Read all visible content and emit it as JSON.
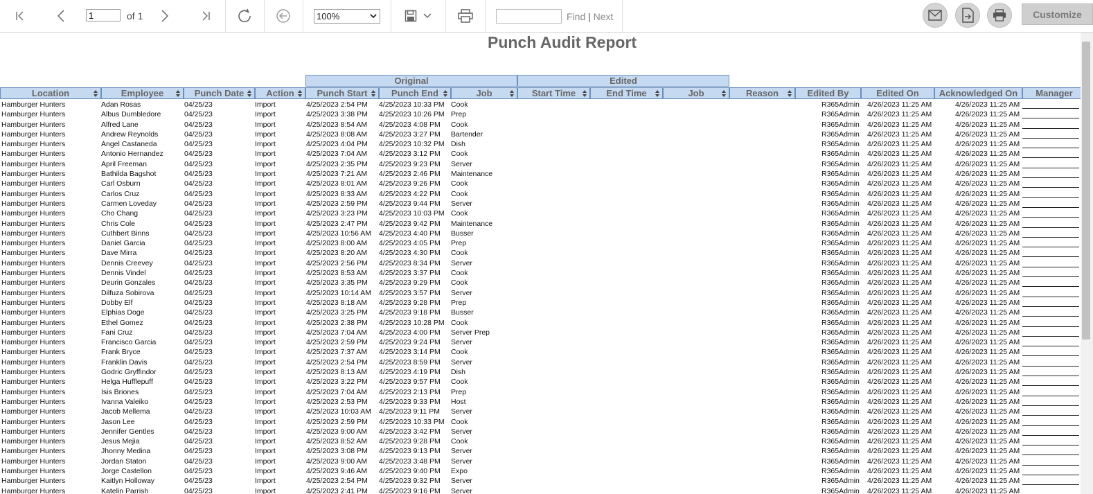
{
  "toolbar": {
    "page_value": "1",
    "page_of": "of 1",
    "zoom": "100%",
    "find_label": "Find",
    "next_label": "Next",
    "find_sep": "|",
    "customize": "Customize"
  },
  "report": {
    "title": "Punch Audit Report",
    "group_original": "Original",
    "group_edited": "Edited",
    "columns": [
      "Location",
      "Employee",
      "Punch Date",
      "Action",
      "Punch Start",
      "Punch End",
      "Job",
      "Start Time",
      "End Time",
      "Job",
      "Reason",
      "Edited By",
      "Edited On",
      "Acknowledged On",
      "Manager"
    ],
    "rows": [
      [
        "Hamburger Hunters",
        "Adan Rosas",
        "04/25/23",
        "Import",
        "4/25/2023 2:54 PM",
        "4/25/2023 10:33 PM",
        "Cook",
        "R365Admin",
        "4/26/2023 11:25 AM",
        "4/26/2023 11:25 AM"
      ],
      [
        "Hamburger Hunters",
        "Albus Dumbledore",
        "04/25/23",
        "Import",
        "4/25/2023 3:38 PM",
        "4/25/2023 10:26 PM",
        "Prep",
        "R365Admin",
        "4/26/2023 11:25 AM",
        "4/26/2023 11:25 AM"
      ],
      [
        "Hamburger Hunters",
        "Alfred Lane",
        "04/25/23",
        "Import",
        "4/25/2023 8:54 AM",
        "4/25/2023 4:08 PM",
        "Cook",
        "R365Admin",
        "4/26/2023 11:25 AM",
        "4/26/2023 11:25 AM"
      ],
      [
        "Hamburger Hunters",
        "Andrew Reynolds",
        "04/25/23",
        "Import",
        "4/25/2023 8:08 AM",
        "4/25/2023 3:27 PM",
        "Bartender",
        "R365Admin",
        "4/26/2023 11:25 AM",
        "4/26/2023 11:25 AM"
      ],
      [
        "Hamburger Hunters",
        "Angel Castaneda",
        "04/25/23",
        "Import",
        "4/25/2023 4:04 PM",
        "4/25/2023 10:32 PM",
        "Dish",
        "R365Admin",
        "4/26/2023 11:25 AM",
        "4/26/2023 11:25 AM"
      ],
      [
        "Hamburger Hunters",
        "Antonio Hernandez",
        "04/25/23",
        "Import",
        "4/25/2023 7:04 AM",
        "4/25/2023 3:12 PM",
        "Cook",
        "R365Admin",
        "4/26/2023 11:25 AM",
        "4/26/2023 11:25 AM"
      ],
      [
        "Hamburger Hunters",
        "April Freeman",
        "04/25/23",
        "Import",
        "4/25/2023 2:35 PM",
        "4/25/2023 9:23 PM",
        "Server",
        "R365Admin",
        "4/26/2023 11:25 AM",
        "4/26/2023 11:25 AM"
      ],
      [
        "Hamburger Hunters",
        "Bathilda Bagshot",
        "04/25/23",
        "Import",
        "4/25/2023 7:21 AM",
        "4/25/2023 2:46 PM",
        "Maintenance",
        "R365Admin",
        "4/26/2023 11:25 AM",
        "4/26/2023 11:25 AM"
      ],
      [
        "Hamburger Hunters",
        "Carl Osburn",
        "04/25/23",
        "Import",
        "4/25/2023 8:01 AM",
        "4/25/2023 9:26 PM",
        "Cook",
        "R365Admin",
        "4/26/2023 11:25 AM",
        "4/26/2023 11:25 AM"
      ],
      [
        "Hamburger Hunters",
        "Carlos Cruz",
        "04/25/23",
        "Import",
        "4/25/2023 8:33 AM",
        "4/25/2023 4:22 PM",
        "Cook",
        "R365Admin",
        "4/26/2023 11:25 AM",
        "4/26/2023 11:25 AM"
      ],
      [
        "Hamburger Hunters",
        "Carmen Loveday",
        "04/25/23",
        "Import",
        "4/25/2023 2:59 PM",
        "4/25/2023 9:44 PM",
        "Server",
        "R365Admin",
        "4/26/2023 11:25 AM",
        "4/26/2023 11:25 AM"
      ],
      [
        "Hamburger Hunters",
        "Cho Chang",
        "04/25/23",
        "Import",
        "4/25/2023 3:23 PM",
        "4/25/2023 10:03 PM",
        "Cook",
        "R365Admin",
        "4/26/2023 11:25 AM",
        "4/26/2023 11:25 AM"
      ],
      [
        "Hamburger Hunters",
        "Chris Cole",
        "04/25/23",
        "Import",
        "4/25/2023 2:47 PM",
        "4/25/2023 9:42 PM",
        "Maintenance",
        "R365Admin",
        "4/26/2023 11:25 AM",
        "4/26/2023 11:25 AM"
      ],
      [
        "Hamburger Hunters",
        "Cuthbert Binns",
        "04/25/23",
        "Import",
        "4/25/2023 10:56 AM",
        "4/25/2023 4:40 PM",
        "Busser",
        "R365Admin",
        "4/26/2023 11:25 AM",
        "4/26/2023 11:25 AM"
      ],
      [
        "Hamburger Hunters",
        "Daniel Garcia",
        "04/25/23",
        "Import",
        "4/25/2023 8:00 AM",
        "4/25/2023 4:05 PM",
        "Prep",
        "R365Admin",
        "4/26/2023 11:25 AM",
        "4/26/2023 11:25 AM"
      ],
      [
        "Hamburger Hunters",
        "Dave Mirra",
        "04/25/23",
        "Import",
        "4/25/2023 8:20 AM",
        "4/25/2023 4:30 PM",
        "Cook",
        "R365Admin",
        "4/26/2023 11:25 AM",
        "4/26/2023 11:25 AM"
      ],
      [
        "Hamburger Hunters",
        "Dennis Creevey",
        "04/25/23",
        "Import",
        "4/25/2023 2:56 PM",
        "4/25/2023 8:34 PM",
        "Server",
        "R365Admin",
        "4/26/2023 11:25 AM",
        "4/26/2023 11:25 AM"
      ],
      [
        "Hamburger Hunters",
        "Dennis Vindel",
        "04/25/23",
        "Import",
        "4/25/2023 8:53 AM",
        "4/25/2023 3:37 PM",
        "Cook",
        "R365Admin",
        "4/26/2023 11:25 AM",
        "4/26/2023 11:25 AM"
      ],
      [
        "Hamburger Hunters",
        "Deurin Gonzales",
        "04/25/23",
        "Import",
        "4/25/2023 3:35 PM",
        "4/25/2023 9:29 PM",
        "Cook",
        "R365Admin",
        "4/26/2023 11:25 AM",
        "4/26/2023 11:25 AM"
      ],
      [
        "Hamburger Hunters",
        "Dilfuza Sobirova",
        "04/25/23",
        "Import",
        "4/25/2023 10:14 AM",
        "4/25/2023 3:57 PM",
        "Server",
        "R365Admin",
        "4/26/2023 11:25 AM",
        "4/26/2023 11:25 AM"
      ],
      [
        "Hamburger Hunters",
        "Dobby Elf",
        "04/25/23",
        "Import",
        "4/25/2023 8:18 AM",
        "4/25/2023 9:28 PM",
        "Prep",
        "R365Admin",
        "4/26/2023 11:25 AM",
        "4/26/2023 11:25 AM"
      ],
      [
        "Hamburger Hunters",
        "Elphias Doge",
        "04/25/23",
        "Import",
        "4/25/2023 3:25 PM",
        "4/25/2023 9:18 PM",
        "Busser",
        "R365Admin",
        "4/26/2023 11:25 AM",
        "4/26/2023 11:25 AM"
      ],
      [
        "Hamburger Hunters",
        "Ethel Gomez",
        "04/25/23",
        "Import",
        "4/25/2023 2:38 PM",
        "4/25/2023 10:28 PM",
        "Cook",
        "R365Admin",
        "4/26/2023 11:25 AM",
        "4/26/2023 11:25 AM"
      ],
      [
        "Hamburger Hunters",
        "Fani Cruz",
        "04/25/23",
        "Import",
        "4/25/2023 7:04 AM",
        "4/25/2023 4:00 PM",
        "Server Prep",
        "R365Admin",
        "4/26/2023 11:25 AM",
        "4/26/2023 11:25 AM"
      ],
      [
        "Hamburger Hunters",
        "Francisco Garcia",
        "04/25/23",
        "Import",
        "4/25/2023 2:59 PM",
        "4/25/2023 9:24 PM",
        "Server",
        "R365Admin",
        "4/26/2023 11:25 AM",
        "4/26/2023 11:25 AM"
      ],
      [
        "Hamburger Hunters",
        "Frank Bryce",
        "04/25/23",
        "Import",
        "4/25/2023 7:37 AM",
        "4/25/2023 3:14 PM",
        "Cook",
        "R365Admin",
        "4/26/2023 11:25 AM",
        "4/26/2023 11:25 AM"
      ],
      [
        "Hamburger Hunters",
        "Franklin Davis",
        "04/25/23",
        "Import",
        "4/25/2023 2:54 PM",
        "4/25/2023 8:59 PM",
        "Server",
        "R365Admin",
        "4/26/2023 11:25 AM",
        "4/26/2023 11:25 AM"
      ],
      [
        "Hamburger Hunters",
        "Godric Gryffindor",
        "04/25/23",
        "Import",
        "4/25/2023 8:13 AM",
        "4/25/2023 4:19 PM",
        "Dish",
        "R365Admin",
        "4/26/2023 11:25 AM",
        "4/26/2023 11:25 AM"
      ],
      [
        "Hamburger Hunters",
        "Helga Hufflepuff",
        "04/25/23",
        "Import",
        "4/25/2023 3:22 PM",
        "4/25/2023 9:57 PM",
        "Cook",
        "R365Admin",
        "4/26/2023 11:25 AM",
        "4/26/2023 11:25 AM"
      ],
      [
        "Hamburger Hunters",
        "Isis Briones",
        "04/25/23",
        "Import",
        "4/25/2023 7:04 AM",
        "4/25/2023 2:13 PM",
        "Prep",
        "R365Admin",
        "4/26/2023 11:25 AM",
        "4/26/2023 11:25 AM"
      ],
      [
        "Hamburger Hunters",
        "Ivanna Valeiko",
        "04/25/23",
        "Import",
        "4/25/2023 2:53 PM",
        "4/25/2023 9:33 PM",
        "Host",
        "R365Admin",
        "4/26/2023 11:25 AM",
        "4/26/2023 11:25 AM"
      ],
      [
        "Hamburger Hunters",
        "Jacob Mellema",
        "04/25/23",
        "Import",
        "4/25/2023 10:03 AM",
        "4/25/2023 9:11 PM",
        "Server",
        "R365Admin",
        "4/26/2023 11:25 AM",
        "4/26/2023 11:25 AM"
      ],
      [
        "Hamburger Hunters",
        "Jason Lee",
        "04/25/23",
        "Import",
        "4/25/2023 2:59 PM",
        "4/25/2023 10:33 PM",
        "Cook",
        "R365Admin",
        "4/26/2023 11:25 AM",
        "4/26/2023 11:25 AM"
      ],
      [
        "Hamburger Hunters",
        "Jennifer Gentles",
        "04/25/23",
        "Import",
        "4/25/2023 9:00 AM",
        "4/25/2023 3:42 PM",
        "Server",
        "R365Admin",
        "4/26/2023 11:25 AM",
        "4/26/2023 11:25 AM"
      ],
      [
        "Hamburger Hunters",
        "Jesus Mejia",
        "04/25/23",
        "Import",
        "4/25/2023 8:52 AM",
        "4/25/2023 9:28 PM",
        "Cook",
        "R365Admin",
        "4/26/2023 11:25 AM",
        "4/26/2023 11:25 AM"
      ],
      [
        "Hamburger Hunters",
        "Jhonny Medina",
        "04/25/23",
        "Import",
        "4/25/2023 3:08 PM",
        "4/25/2023 9:13 PM",
        "Server",
        "R365Admin",
        "4/26/2023 11:25 AM",
        "4/26/2023 11:25 AM"
      ],
      [
        "Hamburger Hunters",
        "Jordan Staton",
        "04/25/23",
        "Import",
        "4/25/2023 9:00 AM",
        "4/25/2023 3:48 PM",
        "Server",
        "R365Admin",
        "4/26/2023 11:25 AM",
        "4/26/2023 11:25 AM"
      ],
      [
        "Hamburger Hunters",
        "Jorge Castellon",
        "04/25/23",
        "Import",
        "4/25/2023 9:46 AM",
        "4/25/2023 9:40 PM",
        "Expo",
        "R365Admin",
        "4/26/2023 11:25 AM",
        "4/26/2023 11:25 AM"
      ],
      [
        "Hamburger Hunters",
        "Kaitlyn Holloway",
        "04/25/23",
        "Import",
        "4/25/2023 2:54 PM",
        "4/25/2023 9:32 PM",
        "Server",
        "R365Admin",
        "4/26/2023 11:25 AM",
        "4/26/2023 11:25 AM"
      ],
      [
        "Hamburger Hunters",
        "Katelin Parrish",
        "04/25/23",
        "Import",
        "4/25/2023 2:41 PM",
        "4/25/2023 9:16 PM",
        "Server",
        "R365Admin",
        "4/26/2023 11:25 AM",
        "4/26/2023 11:25 AM"
      ]
    ]
  }
}
